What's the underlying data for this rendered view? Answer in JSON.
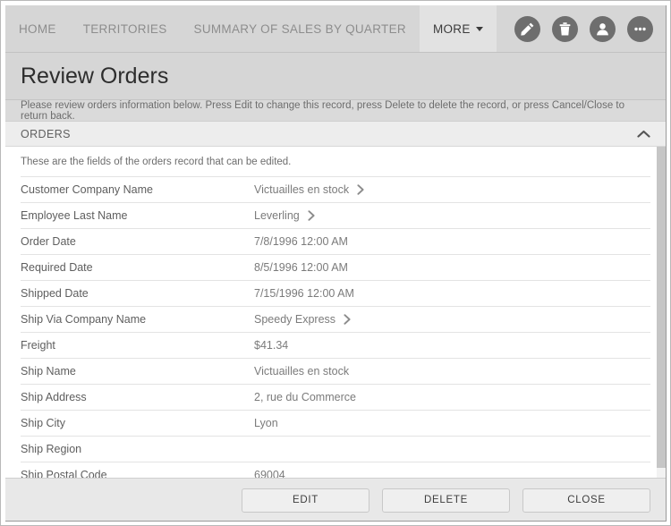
{
  "navbar": {
    "tabs": [
      {
        "label": "Home",
        "name": "nav-tab-home",
        "active": false,
        "caret": false
      },
      {
        "label": "Territories",
        "name": "nav-tab-territories",
        "active": false,
        "caret": false
      },
      {
        "label": "Summary of Sales by Quarter",
        "name": "nav-tab-summary-of-sales-by-quarter",
        "active": false,
        "caret": false
      },
      {
        "label": "More",
        "name": "nav-tab-more",
        "active": true,
        "caret": true
      }
    ],
    "icons": [
      {
        "icon": "pencil-icon",
        "name": "edit-icon-button"
      },
      {
        "icon": "trash-icon",
        "name": "delete-icon-button"
      },
      {
        "icon": "user-icon",
        "name": "account-icon-button"
      },
      {
        "icon": "ellipsis-icon",
        "name": "more-actions-icon-button"
      }
    ]
  },
  "page": {
    "title": "Review Orders",
    "description": "Please review orders information below. Press Edit to change this record, press Delete to delete the record, or press Cancel/Close to return back."
  },
  "section": {
    "title": "ORDERS",
    "toggle_icon": "chevron-up-icon",
    "note": "These are the fields of the orders record that can be edited."
  },
  "fields": [
    {
      "label": "Customer Company Name",
      "value": "Victuailles en stock",
      "chevron": true
    },
    {
      "label": "Employee Last Name",
      "value": "Leverling",
      "chevron": true
    },
    {
      "label": "Order Date",
      "value": "7/8/1996 12:00 AM",
      "chevron": false
    },
    {
      "label": "Required Date",
      "value": "8/5/1996 12:00 AM",
      "chevron": false
    },
    {
      "label": "Shipped Date",
      "value": "7/15/1996 12:00 AM",
      "chevron": false
    },
    {
      "label": "Ship Via Company Name",
      "value": "Speedy Express",
      "chevron": true
    },
    {
      "label": "Freight",
      "value": "$41.34",
      "chevron": false
    },
    {
      "label": "Ship Name",
      "value": "Victuailles en stock",
      "chevron": false
    },
    {
      "label": "Ship Address",
      "value": "2, rue du Commerce",
      "chevron": false
    },
    {
      "label": "Ship City",
      "value": "Lyon",
      "chevron": false
    },
    {
      "label": "Ship Region",
      "value": "",
      "chevron": false
    },
    {
      "label": "Ship Postal Code",
      "value": "69004",
      "chevron": false
    }
  ],
  "footer": {
    "buttons": [
      {
        "label": "Edit",
        "name": "edit-button"
      },
      {
        "label": "Delete",
        "name": "delete-button"
      },
      {
        "label": "Close",
        "name": "close-button"
      }
    ]
  },
  "colors": {
    "chrome": "#d6d6d6",
    "section_header": "#ededed",
    "footer": "#e8e8e8",
    "icon_circle": "#6e6e6e",
    "label_text": "#5e5e5e",
    "value_text": "#7b7b7b"
  }
}
